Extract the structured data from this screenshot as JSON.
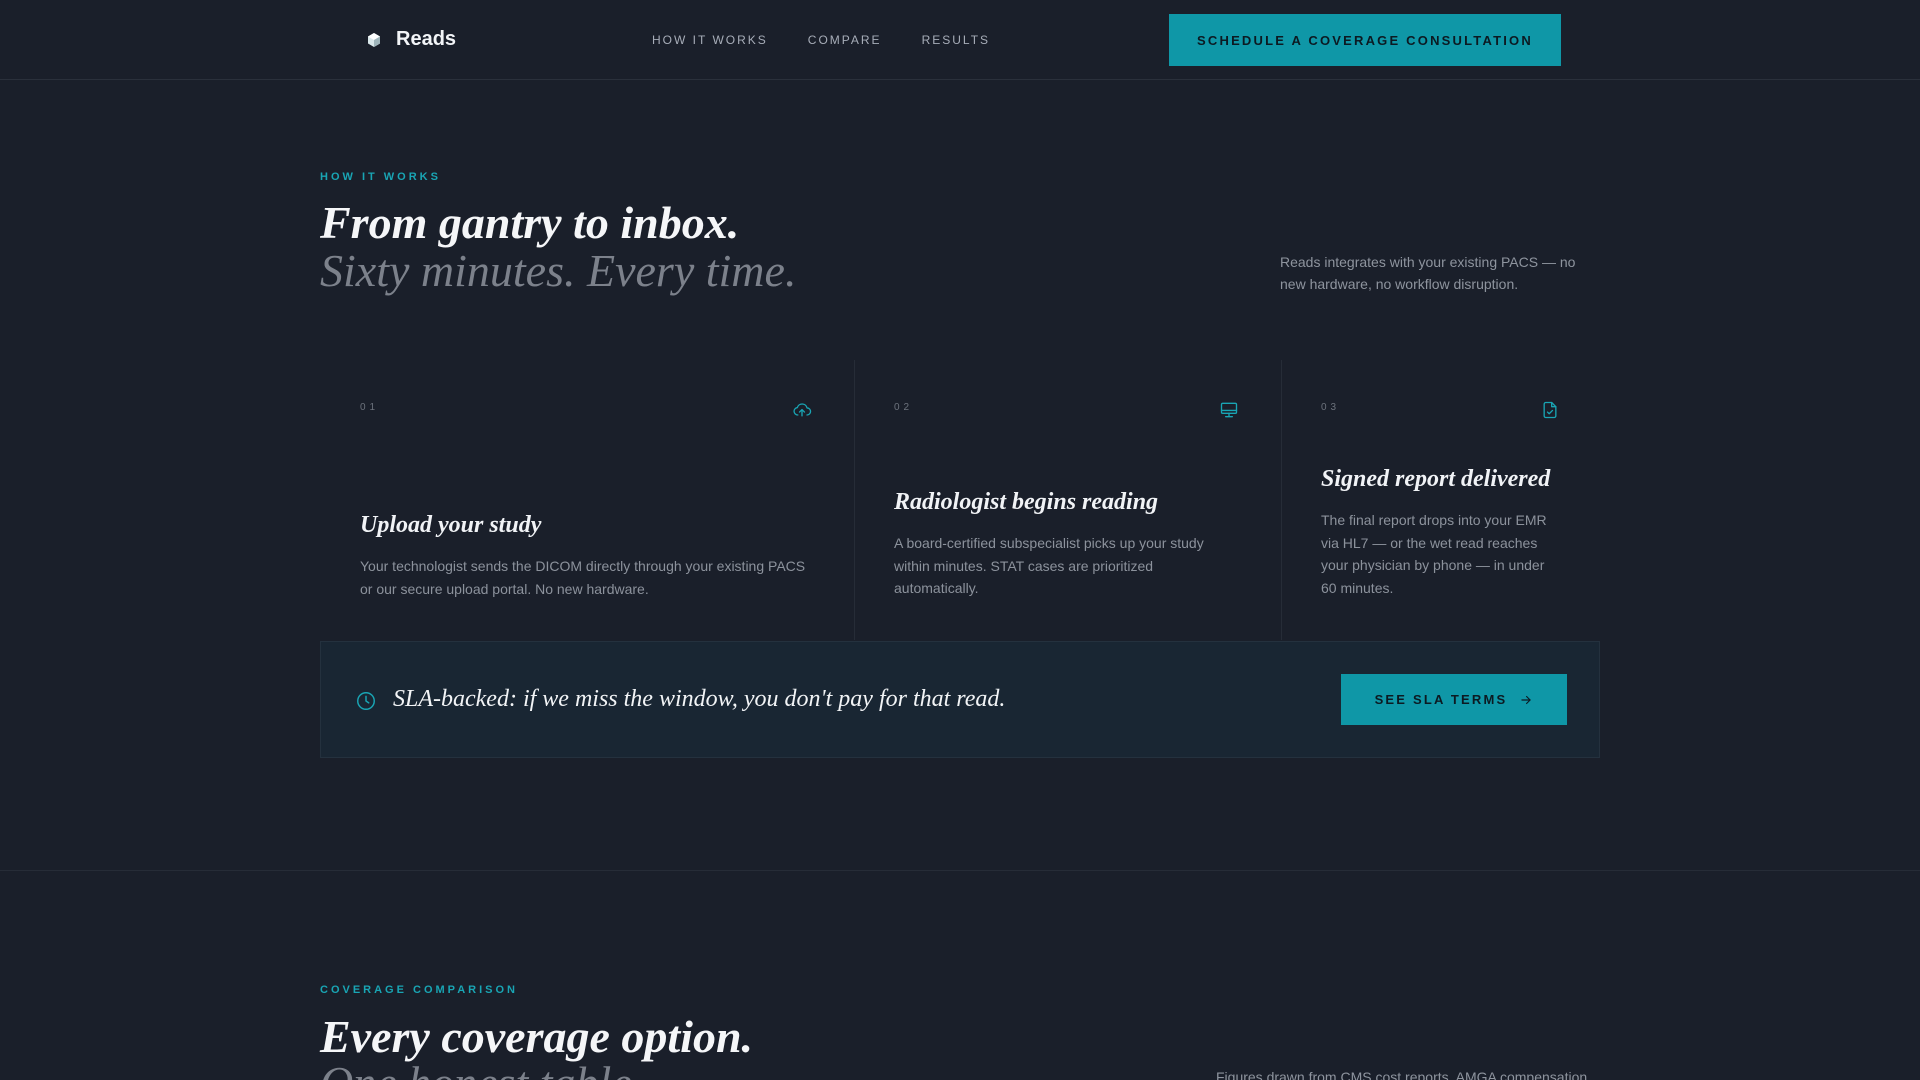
{
  "header": {
    "brand_name": "Reads",
    "nav": [
      "HOW IT WORKS",
      "COMPARE",
      "RESULTS"
    ],
    "cta_label": "SCHEDULE A COVERAGE CONSULTATION"
  },
  "how_it_works": {
    "eyebrow": "HOW IT WORKS",
    "headline": "From gantry to inbox.",
    "subheadline": "Sixty minutes. Every time.",
    "side_note": "Reads integrates with your existing PACS — no new hardware, no workflow disruption.",
    "steps": [
      {
        "number": "01",
        "icon": "cloud-upload-icon",
        "title": "Upload your study",
        "description": "Your technologist sends the DICOM directly through your existing PACS or our secure upload portal. No new hardware."
      },
      {
        "number": "02",
        "icon": "monitor-icon",
        "title": "Radiologist begins reading",
        "description": "A board-certified subspecialist picks up your study within minutes. STAT cases are prioritized automatically."
      },
      {
        "number": "03",
        "icon": "file-check-icon",
        "title": "Signed report delivered",
        "description": "The final report drops into your EMR via HL7 — or the wet read reaches your physician by phone — in under 60 minutes."
      }
    ],
    "sla": {
      "icon": "clock-icon",
      "text": "SLA-backed: if we miss the window, you don't pay for that read.",
      "button_label": "SEE SLA TERMS",
      "button_icon": "arrow-right-icon"
    }
  },
  "coverage": {
    "eyebrow": "COVERAGE COMPARISON",
    "headline": "Every coverage option.",
    "subheadline": "One honest table.",
    "side_note": "Figures drawn from CMS cost reports, AMGA compensation"
  },
  "colors": {
    "background": "#1a1f2a",
    "accent": "#0f97a7",
    "eyebrow": "#19a5b4",
    "sla_panel": "#192633"
  }
}
